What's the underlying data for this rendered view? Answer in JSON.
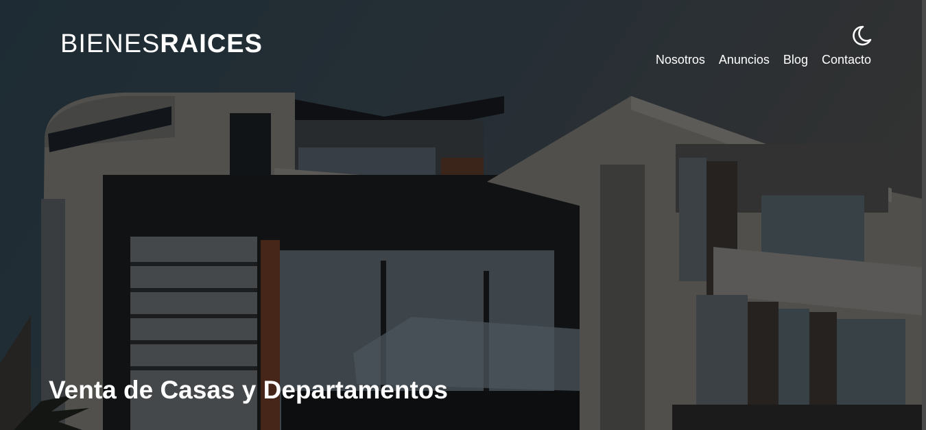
{
  "site": {
    "logo_light": "BIENES",
    "logo_bold": "RAICES"
  },
  "header": {
    "theme_toggle_icon": "moon-icon"
  },
  "nav": {
    "items": [
      {
        "label": "Nosotros"
      },
      {
        "label": "Anuncios"
      },
      {
        "label": "Blog"
      },
      {
        "label": "Contacto"
      }
    ]
  },
  "hero": {
    "title": "Venta de Casas y Departamentos",
    "background_image": "modern-houses-photo"
  },
  "colors": {
    "text": "#ffffff",
    "sky_left": "#2f4352",
    "sky_right": "#4a4a4a"
  }
}
